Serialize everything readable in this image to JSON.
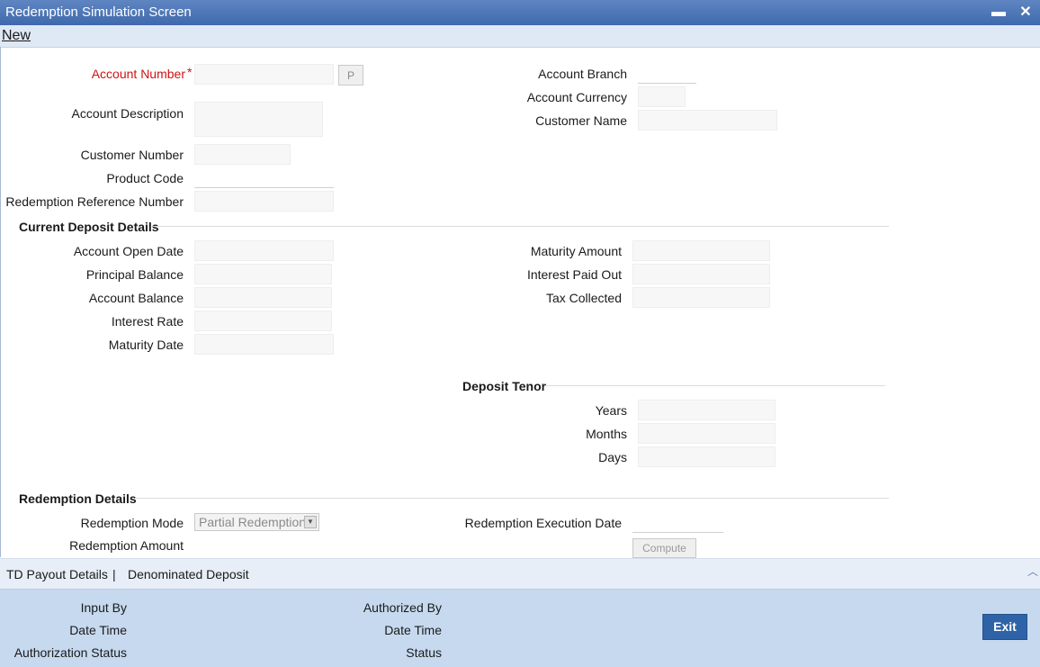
{
  "window": {
    "title": "Redemption Simulation Screen",
    "minimize": "▬",
    "close": "✕"
  },
  "menu": {
    "new": "New"
  },
  "main": {
    "account_number": "Account Number",
    "required_mark": "*",
    "p_button": "P",
    "account_description": "Account Description",
    "customer_number": "Customer Number",
    "product_code": "Product Code",
    "redemption_reference_number": "Redemption Reference Number",
    "account_branch": "Account Branch",
    "account_currency": "Account Currency",
    "customer_name": "Customer Name"
  },
  "current_deposit": {
    "title": "Current Deposit Details",
    "account_open_date": "Account Open Date",
    "principal_balance": "Principal Balance",
    "account_balance": "Account Balance",
    "interest_rate": "Interest Rate",
    "maturity_date": "Maturity Date",
    "maturity_amount": "Maturity Amount",
    "interest_paid_out": "Interest Paid Out",
    "tax_collected": "Tax Collected"
  },
  "deposit_tenor": {
    "title": "Deposit Tenor",
    "years": "Years",
    "months": "Months",
    "days": "Days"
  },
  "redemption": {
    "title": "Redemption Details",
    "mode": "Redemption Mode",
    "mode_value": "Partial Redemption",
    "amount": "Redemption Amount",
    "execution_date": "Redemption Execution Date",
    "compute": "Compute"
  },
  "tabs": {
    "payout": "TD Payout Details",
    "separator": "|",
    "denominated": "Denominated Deposit"
  },
  "footer": {
    "input_by": "Input By",
    "date_time_1": "Date Time",
    "authorization_status": "Authorization Status",
    "authorized_by": "Authorized By",
    "date_time_2": "Date Time",
    "status": "Status",
    "exit": "Exit"
  }
}
